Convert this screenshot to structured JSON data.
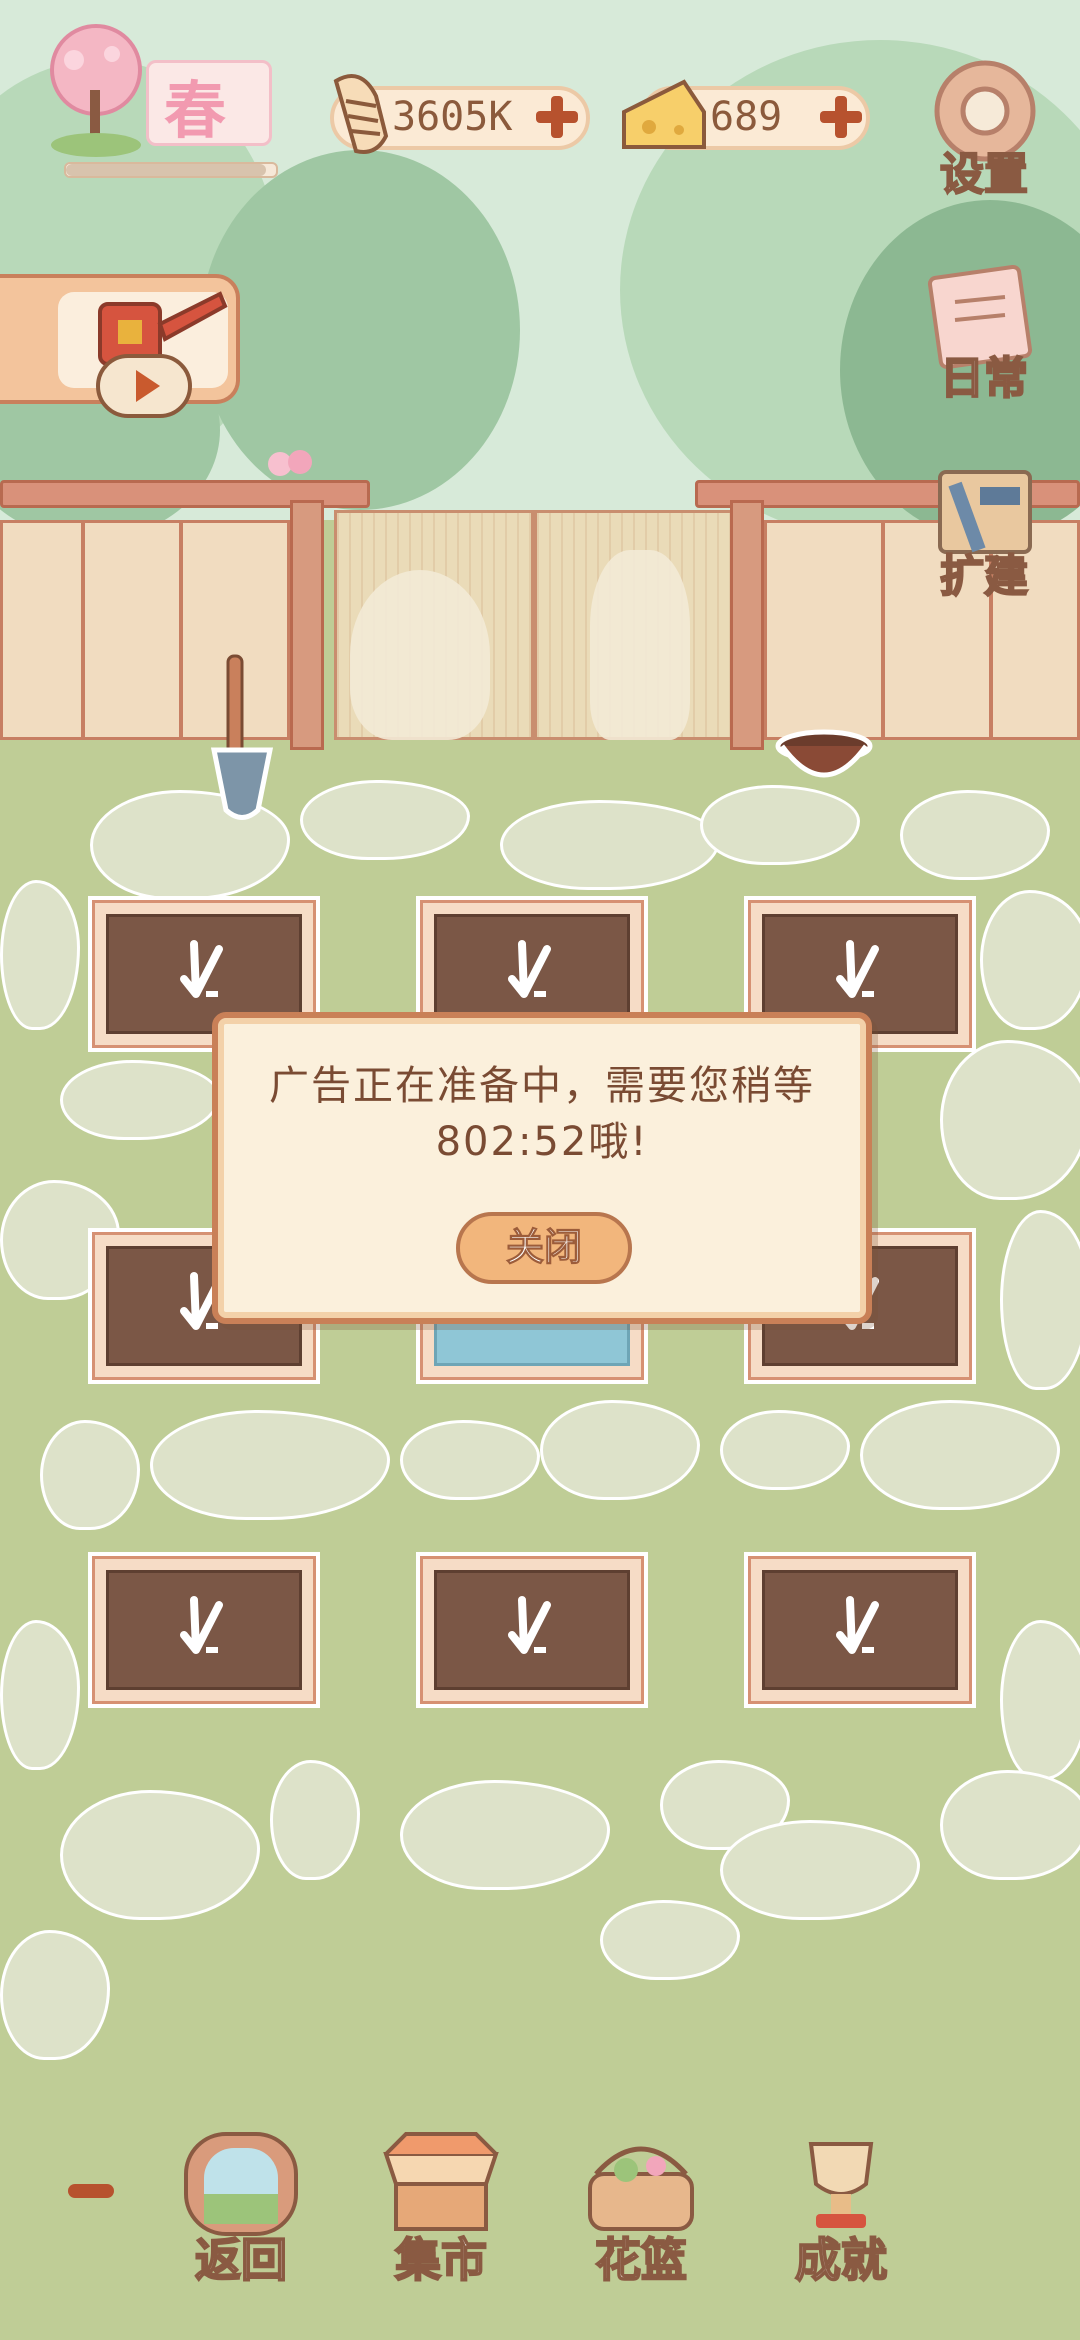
{
  "season": {
    "label": "春",
    "progress": 0.95
  },
  "currency": {
    "fish": {
      "value": "3605K",
      "icon": "fish-bone-icon"
    },
    "cheese": {
      "value": "689",
      "icon": "cheese-icon"
    }
  },
  "side_buttons": {
    "settings": "设置",
    "daily": "日常",
    "expand": "扩建"
  },
  "dialog": {
    "message": "广告正在准备中，需要您稍等802:52哦!",
    "close_label": "关闭"
  },
  "bottom_nav": {
    "back": "返回",
    "market": "集市",
    "flower_basket": "花篮",
    "achievement": "成就"
  },
  "colors": {
    "grass": "#bfcd96",
    "soil": "#7b5746",
    "accent": "#c98057"
  }
}
